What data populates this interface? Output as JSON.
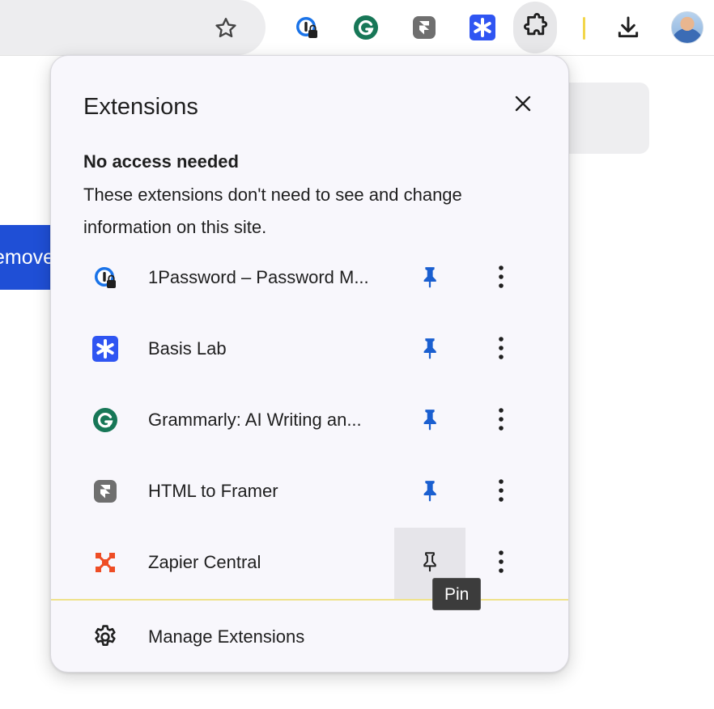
{
  "toolbar": {
    "icons": [
      "star-icon",
      "1password-icon",
      "grammarly-icon",
      "html-to-framer-icon",
      "basis-lab-icon",
      "extensions-puzzle-icon",
      "download-icon",
      "avatar"
    ]
  },
  "background": {
    "button_partial_text": "emove"
  },
  "popup": {
    "title": "Extensions",
    "section_heading": "No access needed",
    "section_description": "These extensions don't need to see and change information on this site.",
    "extensions": [
      {
        "name": "1Password – Password M...",
        "icon": "1password-icon",
        "pinned": true
      },
      {
        "name": "Basis Lab",
        "icon": "basis-lab-icon",
        "pinned": true
      },
      {
        "name": "Grammarly: AI Writing an...",
        "icon": "grammarly-icon",
        "pinned": true
      },
      {
        "name": "HTML to Framer",
        "icon": "html-to-framer-icon",
        "pinned": true
      },
      {
        "name": "Zapier Central",
        "icon": "zapier-icon",
        "pinned": false
      }
    ],
    "tooltip": "Pin",
    "manage_label": "Manage Extensions"
  },
  "colors": {
    "pin_blue": "#1a5fd0",
    "basis_blue": "#2f55f2",
    "grammarly_green": "#177757",
    "zapier_orange": "#ee4d25"
  }
}
